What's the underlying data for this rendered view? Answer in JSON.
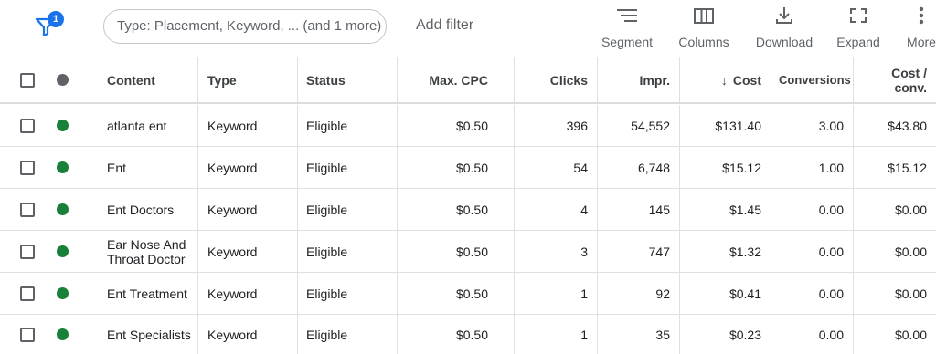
{
  "toolbar": {
    "filter_count": "1",
    "search_placeholder": "Type: Placement, Keyword, ... (and 1 more)",
    "add_filter": "Add filter",
    "segment": "Segment",
    "columns": "Columns",
    "download": "Download",
    "expand": "Expand",
    "more": "More"
  },
  "table": {
    "headers": {
      "content": "Content",
      "type": "Type",
      "status": "Status",
      "max_cpc": "Max. CPC",
      "clicks": "Clicks",
      "impr": "Impr.",
      "cost": "Cost",
      "cost_sort_arrow": "↓",
      "conversions": "Conversions",
      "cost_conv_line1": "Cost /",
      "cost_conv_line2": "conv."
    },
    "rows": [
      {
        "content": "atlanta ent",
        "type": "Keyword",
        "status": "Eligible",
        "max_cpc": "$0.50",
        "clicks": "396",
        "impr": "54,552",
        "cost": "$131.40",
        "conversions": "3.00",
        "cost_conv": "$43.80"
      },
      {
        "content": "Ent",
        "type": "Keyword",
        "status": "Eligible",
        "max_cpc": "$0.50",
        "clicks": "54",
        "impr": "6,748",
        "cost": "$15.12",
        "conversions": "1.00",
        "cost_conv": "$15.12"
      },
      {
        "content": "Ent Doctors",
        "type": "Keyword",
        "status": "Eligible",
        "max_cpc": "$0.50",
        "clicks": "4",
        "impr": "145",
        "cost": "$1.45",
        "conversions": "0.00",
        "cost_conv": "$0.00"
      },
      {
        "content": "Ear Nose And",
        "content_line2": "Throat Doctor",
        "type": "Keyword",
        "status": "Eligible",
        "max_cpc": "$0.50",
        "clicks": "3",
        "impr": "747",
        "cost": "$1.32",
        "conversions": "0.00",
        "cost_conv": "$0.00"
      },
      {
        "content": "Ent Treatment",
        "type": "Keyword",
        "status": "Eligible",
        "max_cpc": "$0.50",
        "clicks": "1",
        "impr": "92",
        "cost": "$0.41",
        "conversions": "0.00",
        "cost_conv": "$0.00"
      },
      {
        "content": "Ent Specialists",
        "type": "Keyword",
        "status": "Eligible",
        "max_cpc": "$0.50",
        "clicks": "1",
        "impr": "35",
        "cost": "$0.23",
        "conversions": "0.00",
        "cost_conv": "$0.00"
      }
    ]
  },
  "colors": {
    "accent": "#1a73e8",
    "status_enabled": "#188038",
    "status_header": "#5f6368"
  },
  "icons": [
    "filter-icon",
    "segment-icon",
    "columns-icon",
    "download-icon",
    "expand-icon",
    "more-vert-icon"
  ]
}
